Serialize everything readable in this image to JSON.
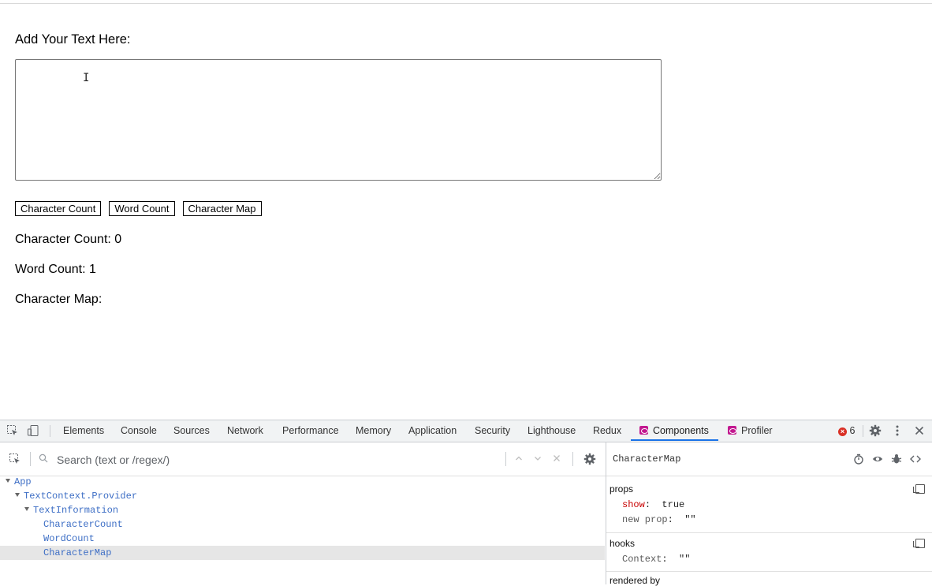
{
  "app": {
    "add_label": "Add Your Text Here:",
    "textarea_value": "",
    "buttons": [
      "Character Count",
      "Word Count",
      "Character Map"
    ],
    "results": {
      "character_count": "Character Count: 0",
      "word_count": "Word Count: 1",
      "character_map": "Character Map:"
    }
  },
  "devtools": {
    "tabs": [
      "Elements",
      "Console",
      "Sources",
      "Network",
      "Performance",
      "Memory",
      "Application",
      "Security",
      "Lighthouse",
      "Redux",
      "Components",
      "Profiler"
    ],
    "active_tab": "Components",
    "error_count": "6",
    "accent_color": "#1a73e8",
    "search": {
      "placeholder": "Search (text or /regex/)"
    },
    "tree": [
      {
        "label": "App",
        "depth": 0,
        "expanded": true,
        "selected": false
      },
      {
        "label": "TextContext.Provider",
        "depth": 1,
        "expanded": true,
        "selected": false
      },
      {
        "label": "TextInformation",
        "depth": 2,
        "expanded": true,
        "selected": false
      },
      {
        "label": "CharacterCount",
        "depth": 3,
        "expanded": false,
        "selected": false
      },
      {
        "label": "WordCount",
        "depth": 3,
        "expanded": false,
        "selected": false
      },
      {
        "label": "CharacterMap",
        "depth": 3,
        "expanded": false,
        "selected": true
      }
    ],
    "inspector": {
      "component": "CharacterMap",
      "props_title": "props",
      "props": [
        {
          "key": "show",
          "value": "true"
        },
        {
          "key": "new prop",
          "value": "\"\""
        }
      ],
      "hooks_title": "hooks",
      "hooks": [
        {
          "key": "Context",
          "value": "\"\""
        }
      ],
      "rendered_by_title": "rendered by"
    }
  }
}
